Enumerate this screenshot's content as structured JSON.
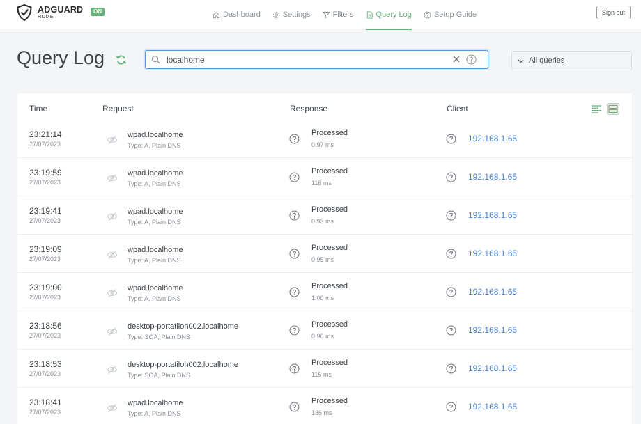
{
  "brand": {
    "name": "ADGUARD",
    "sub": "HOME",
    "status_badge": "ON",
    "accent": "#67b279"
  },
  "nav": [
    {
      "label": "Dashboard",
      "icon": "home-icon"
    },
    {
      "label": "Settings",
      "icon": "gear-icon"
    },
    {
      "label": "Filters",
      "icon": "funnel-icon"
    },
    {
      "label": "Query Log",
      "icon": "document-icon",
      "active": true
    },
    {
      "label": "Setup Guide",
      "icon": "help-circle-icon"
    }
  ],
  "signout_label": "Sign out",
  "page": {
    "title": "Query Log",
    "search_value": "localhome",
    "filter_label": "All queries"
  },
  "table": {
    "headers": {
      "time": "Time",
      "request": "Request",
      "response": "Response",
      "client": "Client"
    },
    "rows": [
      {
        "time": "23:21:14",
        "date": "27/07/2023",
        "domain": "wpad.localhome",
        "type": "Type: A, Plain DNS",
        "status": "Processed",
        "elapsed": "0.97 ms",
        "client": "192.168.1.65"
      },
      {
        "time": "23:19:59",
        "date": "27/07/2023",
        "domain": "wpad.localhome",
        "type": "Type: A, Plain DNS",
        "status": "Processed",
        "elapsed": "116 ms",
        "client": "192.168.1.65"
      },
      {
        "time": "23:19:41",
        "date": "27/07/2023",
        "domain": "wpad.localhome",
        "type": "Type: A, Plain DNS",
        "status": "Processed",
        "elapsed": "0.93 ms",
        "client": "192.168.1.65"
      },
      {
        "time": "23:19:09",
        "date": "27/07/2023",
        "domain": "wpad.localhome",
        "type": "Type: A, Plain DNS",
        "status": "Processed",
        "elapsed": "0.95 ms",
        "client": "192.168.1.65"
      },
      {
        "time": "23:19:00",
        "date": "27/07/2023",
        "domain": "wpad.localhome",
        "type": "Type: A, Plain DNS",
        "status": "Processed",
        "elapsed": "1.00 ms",
        "client": "192.168.1.65"
      },
      {
        "time": "23:18:56",
        "date": "27/07/2023",
        "domain": "desktop-portatiloh002.localhome",
        "type": "Type: SOA, Plain DNS",
        "status": "Processed",
        "elapsed": "0.96 ms",
        "client": "192.168.1.65"
      },
      {
        "time": "23:18:53",
        "date": "27/07/2023",
        "domain": "desktop-portatiloh002.localhome",
        "type": "Type: SOA, Plain DNS",
        "status": "Processed",
        "elapsed": "115 ms",
        "client": "192.168.1.65"
      },
      {
        "time": "23:18:41",
        "date": "27/07/2023",
        "domain": "wpad.localhome",
        "type": "Type: A, Plain DNS",
        "status": "Processed",
        "elapsed": "186 ms",
        "client": "192.168.1.65"
      }
    ]
  }
}
